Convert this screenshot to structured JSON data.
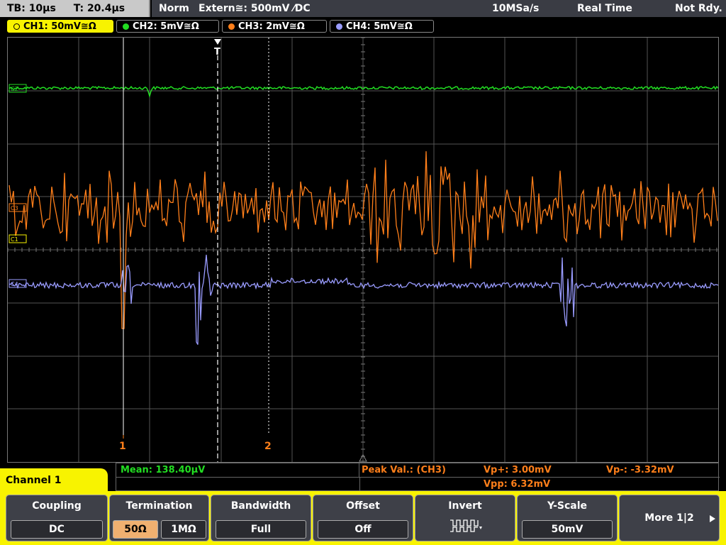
{
  "status": {
    "timebase": "TB: 10µs",
    "trigger_time": "T: 20.4µs",
    "mode": "Norm",
    "trigger_source": "Extern≅: 500mV ⁄DC",
    "sample_rate": "10MSa/s",
    "acquisition": "Real Time",
    "state": "Not Rdy."
  },
  "channels": [
    {
      "id": "ch1",
      "label": "CH1: 50mV≅Ω",
      "color": "#f8f300"
    },
    {
      "id": "ch2",
      "label": "CH2: 5mV≅Ω",
      "color": "#22dd22"
    },
    {
      "id": "ch3",
      "label": "CH3: 2mV≅Ω",
      "color": "#ff7f1a"
    },
    {
      "id": "ch4",
      "label": "CH4: 5mV≅Ω",
      "color": "#9a9cff"
    }
  ],
  "markers": {
    "trigger": "T",
    "cursor1": "1",
    "cursor2": "2",
    "ch2_tag": "C2",
    "ch3_tag": "C3",
    "ch1_tag": "C1",
    "ch4_tag": "C4"
  },
  "measurements": {
    "mean": "Mean: 138.40µV",
    "peak_label": "Peak Val.:  (CH3)",
    "vp_plus": "Vp+: 3.00mV",
    "vp_minus": "Vp-: -3.32mV",
    "vpp": "Vpp: 6.32mV"
  },
  "menu": {
    "title": "Channel 1",
    "coupling": {
      "title": "Coupling",
      "value": "DC"
    },
    "termination": {
      "title": "Termination",
      "opt1": "50Ω",
      "opt2": "1MΩ"
    },
    "bandwidth": {
      "title": "Bandwidth",
      "value": "Full"
    },
    "offset": {
      "title": "Offset",
      "value": "Off"
    },
    "invert": {
      "title": "Invert"
    },
    "yscale": {
      "title": "Y-Scale",
      "value": "50mV"
    },
    "more": {
      "label": "More 1|2"
    }
  }
}
